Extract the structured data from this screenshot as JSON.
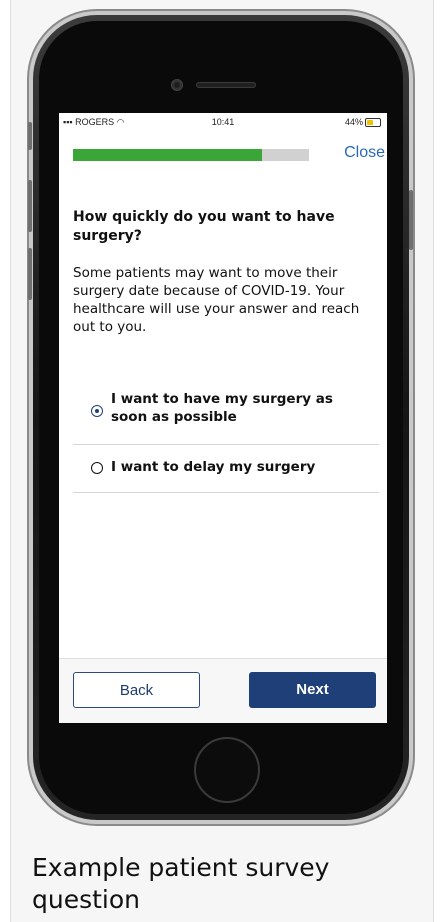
{
  "status_bar": {
    "carrier": "ROGERS",
    "time": "10:41",
    "battery": "44%"
  },
  "progress": {
    "fraction": 0.8
  },
  "header": {
    "close_label": "Close"
  },
  "question": {
    "title": "How quickly do you want to have surgery?",
    "description": "Some patients may want to move their surgery date because of COVID-19. Your healthcare will use your answer and reach out to you."
  },
  "options": [
    {
      "label": "I want to have my surgery as soon as possible",
      "selected": true
    },
    {
      "label": "I want to delay my surgery",
      "selected": false
    }
  ],
  "footer": {
    "back_label": "Back",
    "next_label": "Next"
  },
  "caption": "Example patient survey question",
  "colors": {
    "progress_fill": "#3aa63a",
    "primary": "#1f3f78",
    "link": "#2a6ab3"
  }
}
